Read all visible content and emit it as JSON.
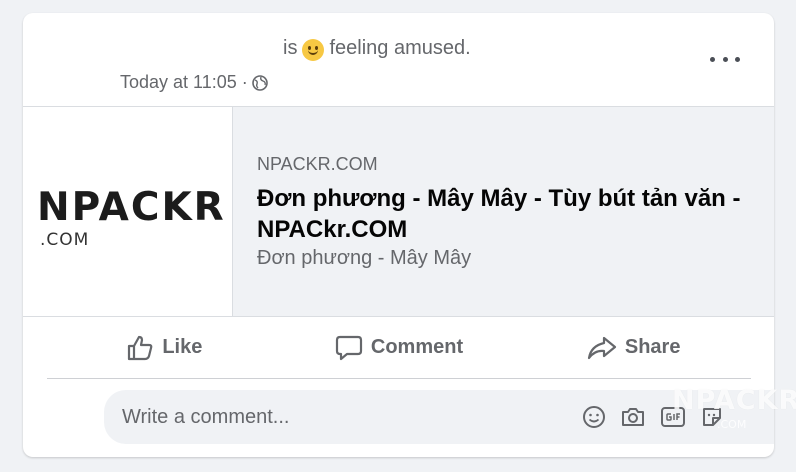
{
  "post": {
    "status_prefix": "is",
    "feeling_icon": "slightly-smiling-face-emoji",
    "status_feeling": "feeling amused.",
    "timestamp": "Today at 11:05 ·",
    "audience_icon": "globe-icon"
  },
  "link_preview": {
    "logo_main": "NPACKR",
    "logo_sub": ".COM",
    "domain": "NPACKR.COM",
    "title": "Đơn phương - Mây Mây - Tùy bút tản văn - NPACkr.COM",
    "description": "Đơn phương - Mây Mây"
  },
  "actions": {
    "like_label": "Like",
    "comment_label": "Comment",
    "share_label": "Share"
  },
  "comment": {
    "placeholder": "Write a comment...",
    "icons": [
      "emoji-icon",
      "camera-icon",
      "gif-icon",
      "sticker-icon"
    ]
  },
  "watermark": {
    "text": "NPACKR",
    "sub": ".COM"
  },
  "colors": {
    "card_bg": "#ffffff",
    "page_bg": "#f0f2f5",
    "secondary_text": "#65676b",
    "primary_text": "#050505",
    "divider": "#dadde1"
  }
}
